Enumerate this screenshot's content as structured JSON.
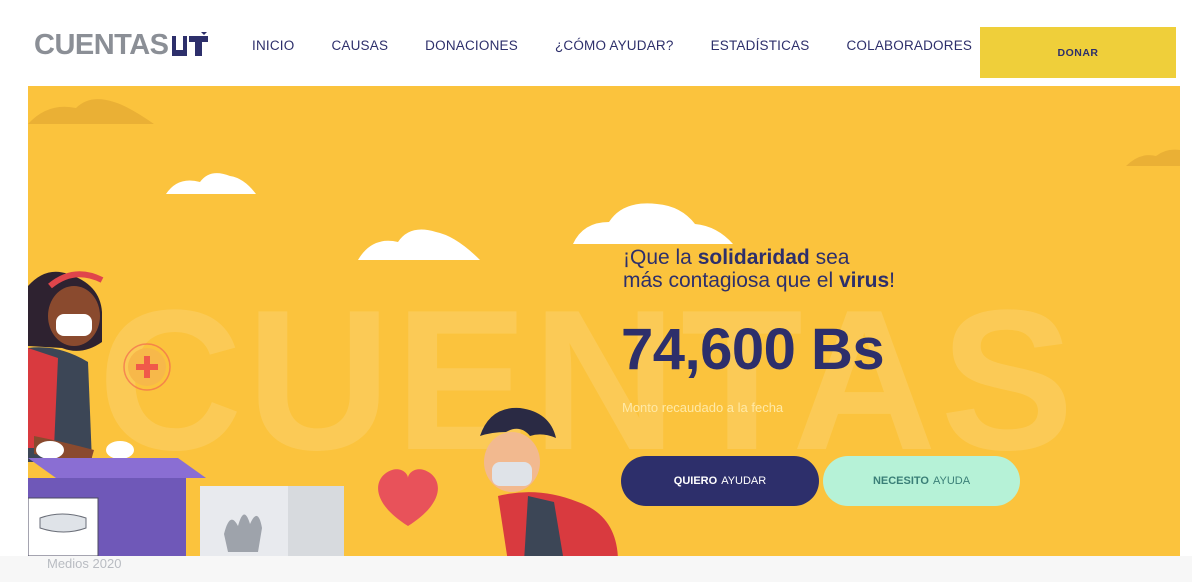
{
  "header": {
    "logo_text": "CUENTAS",
    "nav": [
      "INICIO",
      "CAUSAS",
      "DONACIONES",
      "¿CÓMO AYUDAR?",
      "ESTADÍSTICAS",
      "COLABORADORES"
    ],
    "donate_label": "DONAR"
  },
  "hero": {
    "watermark": "CUENTAS",
    "tagline": {
      "line1_a": "¡Que la ",
      "line1_b": "solidaridad",
      "line1_c": " sea",
      "line2_a": "más contagiosa que el ",
      "line2_b": "virus",
      "line2_c": "!"
    },
    "amount": "74,600 Bs",
    "amount_caption": "Monto recaudado a la fecha",
    "btn_help": {
      "strong": "QUIERO",
      "rest": "AYUDAR"
    },
    "btn_need": {
      "strong": "NECESITO",
      "rest": "AYUDA"
    }
  },
  "bottom": {
    "text": "Medios 2020"
  },
  "colors": {
    "accent": "#fbc33d",
    "navy": "#2d2f6b",
    "mint": "#b6f2d7",
    "donate": "#efcf3a"
  }
}
